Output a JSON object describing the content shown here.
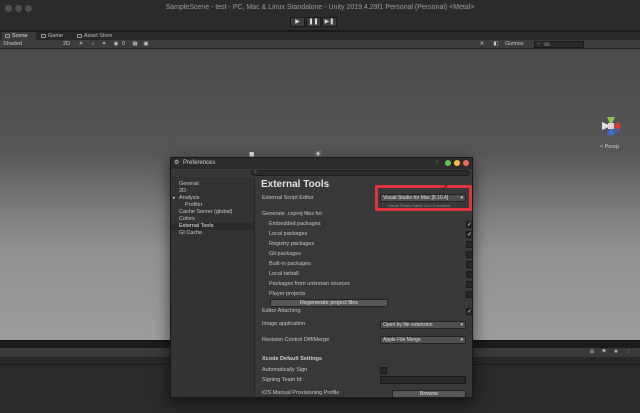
{
  "window": {
    "title": "SampleScene - test - PC, Mac & Linux Standalone - Unity 2019.4.29f1 Personal (Personal) <Metal>",
    "play_controls": [
      "▶",
      "❚❚",
      "▶❚"
    ]
  },
  "tabs": [
    {
      "label": "Scene",
      "icon": "scene-icon"
    },
    {
      "label": "Game",
      "icon": "game-icon"
    },
    {
      "label": "Asset Store",
      "icon": "asset-store-icon"
    }
  ],
  "scene_toolbar": {
    "shading_mode": "Shaded",
    "mode_2d": "2D",
    "audio_icon": "audio-icon",
    "effects_icon": "effects-icon",
    "hidden_count": "0",
    "tools_icon": "tools-icon",
    "gizmos_label": "Gizmos",
    "search_placeholder": "All"
  },
  "scene_view": {
    "persp_label": "< Persp",
    "light_icon": "light-icon",
    "camera_icon": "camera-icon"
  },
  "preferences": {
    "title": "Preferences",
    "sidebar": [
      {
        "label": "General",
        "sub": false,
        "selected": false
      },
      {
        "label": "2D",
        "sub": false,
        "selected": false
      },
      {
        "label": "Analysis",
        "sub": false,
        "selected": false
      },
      {
        "label": "Profiler",
        "sub": true,
        "selected": false
      },
      {
        "label": "Cache Server (global)",
        "sub": false,
        "selected": false
      },
      {
        "label": "Colors",
        "sub": false,
        "selected": false
      },
      {
        "label": "External Tools",
        "sub": false,
        "selected": true
      },
      {
        "label": "GI Cache",
        "sub": false,
        "selected": false
      }
    ],
    "heading": "External Tools",
    "external_script_editor_label": "External Script Editor",
    "external_script_editor_value": "Visual Studio for Mac [8.10.4]",
    "editor_version_note": "Visual Studio Editor v2.0.9 enabled",
    "generate_label": "Generate .csproj files for:",
    "csproj_options": [
      {
        "label": "Embedded packages",
        "checked": true
      },
      {
        "label": "Local packages",
        "checked": true
      },
      {
        "label": "Registry packages",
        "checked": false
      },
      {
        "label": "Git packages",
        "checked": false
      },
      {
        "label": "Built-in packages",
        "checked": false
      },
      {
        "label": "Local tarball",
        "checked": false
      },
      {
        "label": "Packages from unknown sources",
        "checked": false
      },
      {
        "label": "Player projects",
        "checked": false
      }
    ],
    "regenerate_button": "Regenerate project files",
    "editor_attaching_label": "Editor Attaching",
    "editor_attaching_checked": true,
    "image_application_label": "Image application",
    "image_application_value": "Open by file extension",
    "revision_control_label": "Revision Control Diff/Merge",
    "revision_control_value": "Apple File Merge",
    "xcode_heading": "Xcode Default Settings",
    "auto_sign_label": "Automatically Sign",
    "auto_sign_checked": false,
    "signing_team_label": "Signing Team Id:",
    "ios_profile_label": "iOS Manual Provisioning Profile",
    "browse_button": "Browse"
  },
  "colors": {
    "highlight_box": "#e0343d",
    "traffic_close": "#ed6a5e",
    "traffic_min": "#f5bf4f",
    "traffic_max": "#61c554"
  }
}
